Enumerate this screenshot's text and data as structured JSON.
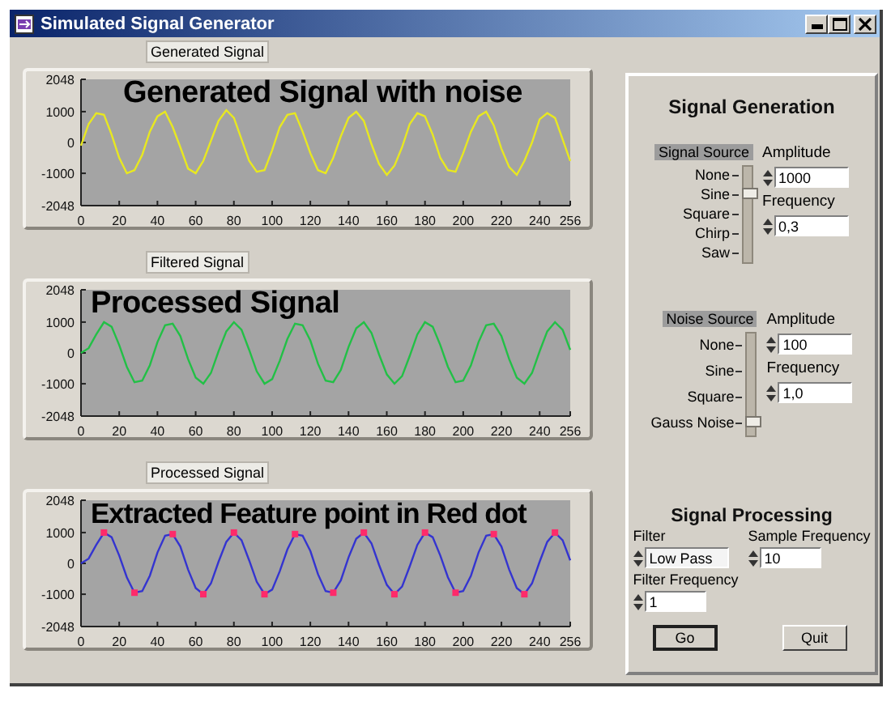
{
  "window": {
    "title": "Simulated Signal Generator"
  },
  "graphs": [
    {
      "label": "Generated Signal",
      "caption": "Generated Signal with noise",
      "chart_data": {
        "type": "line",
        "xlim": [
          0,
          256
        ],
        "ylim": [
          -2048,
          2048
        ],
        "xticks": [
          0,
          20,
          40,
          60,
          80,
          100,
          120,
          140,
          160,
          180,
          200,
          220,
          240,
          256
        ],
        "yticks": [
          -2048,
          -1000,
          0,
          1000,
          2048
        ],
        "x": [
          0,
          4,
          8,
          12,
          16,
          20,
          24,
          28,
          32,
          36,
          40,
          44,
          48,
          52,
          56,
          60,
          64,
          68,
          72,
          76,
          80,
          84,
          88,
          92,
          96,
          100,
          104,
          108,
          112,
          116,
          120,
          124,
          128,
          132,
          136,
          140,
          144,
          148,
          152,
          156,
          160,
          164,
          168,
          172,
          176,
          180,
          184,
          188,
          192,
          196,
          200,
          204,
          208,
          212,
          216,
          220,
          224,
          228,
          232,
          236,
          240,
          244,
          248,
          252,
          256
        ],
        "series": [
          {
            "color": "#e8e820",
            "values": [
              -100,
              600,
              950,
              900,
              250,
              -500,
              -1000,
              -900,
              -400,
              350,
              850,
              1000,
              500,
              -150,
              -850,
              -1000,
              -600,
              50,
              700,
              1050,
              800,
              100,
              -600,
              -950,
              -900,
              -250,
              500,
              900,
              950,
              350,
              -350,
              -900,
              -1000,
              -500,
              200,
              800,
              1000,
              700,
              -50,
              -700,
              -1050,
              -750,
              -150,
              600,
              950,
              850,
              250,
              -500,
              -900,
              -950,
              -350,
              350,
              850,
              1000,
              550,
              -200,
              -800,
              -1050,
              -600,
              0,
              750,
              950,
              800,
              100,
              -600
            ]
          }
        ]
      }
    },
    {
      "label": "Filtered Signal",
      "caption": "Processed Signal",
      "chart_data": {
        "type": "line",
        "xlim": [
          0,
          256
        ],
        "ylim": [
          -2048,
          2048
        ],
        "xticks": [
          0,
          20,
          40,
          60,
          80,
          100,
          120,
          140,
          160,
          180,
          200,
          220,
          240,
          256
        ],
        "yticks": [
          -2048,
          -1000,
          0,
          1000,
          2048
        ],
        "x": [
          0,
          4,
          8,
          12,
          16,
          20,
          24,
          28,
          32,
          36,
          40,
          44,
          48,
          52,
          56,
          60,
          64,
          68,
          72,
          76,
          80,
          84,
          88,
          92,
          96,
          100,
          104,
          108,
          112,
          116,
          120,
          124,
          128,
          132,
          136,
          140,
          144,
          148,
          152,
          156,
          160,
          164,
          168,
          172,
          176,
          180,
          184,
          188,
          192,
          196,
          200,
          204,
          208,
          212,
          216,
          220,
          224,
          228,
          232,
          236,
          240,
          244,
          248,
          252,
          256
        ],
        "series": [
          {
            "color": "#22c046",
            "values": [
              0,
              150,
              600,
              1000,
              850,
              250,
              -450,
              -950,
              -900,
              -400,
              350,
              900,
              950,
              550,
              -200,
              -800,
              -1000,
              -650,
              50,
              700,
              1000,
              750,
              100,
              -600,
              -1000,
              -850,
              -250,
              450,
              950,
              900,
              400,
              -350,
              -900,
              -950,
              -550,
              200,
              800,
              1000,
              650,
              -50,
              -700,
              -1000,
              -750,
              -100,
              600,
              1000,
              850,
              250,
              -450,
              -950,
              -900,
              -400,
              350,
              900,
              950,
              550,
              -200,
              -800,
              -1000,
              -650,
              50,
              700,
              1000,
              750,
              100
            ]
          }
        ]
      }
    },
    {
      "label": "Processed Signal",
      "caption": "Extracted Feature point in Red dot",
      "chart_data": {
        "type": "line",
        "xlim": [
          0,
          256
        ],
        "ylim": [
          -2048,
          2048
        ],
        "xticks": [
          0,
          20,
          40,
          60,
          80,
          100,
          120,
          140,
          160,
          180,
          200,
          220,
          240,
          256
        ],
        "yticks": [
          -2048,
          -1000,
          0,
          1000,
          2048
        ],
        "x": [
          0,
          4,
          8,
          12,
          16,
          20,
          24,
          28,
          32,
          36,
          40,
          44,
          48,
          52,
          56,
          60,
          64,
          68,
          72,
          76,
          80,
          84,
          88,
          92,
          96,
          100,
          104,
          108,
          112,
          116,
          120,
          124,
          128,
          132,
          136,
          140,
          144,
          148,
          152,
          156,
          160,
          164,
          168,
          172,
          176,
          180,
          184,
          188,
          192,
          196,
          200,
          204,
          208,
          212,
          216,
          220,
          224,
          228,
          232,
          236,
          240,
          244,
          248,
          252,
          256
        ],
        "series": [
          {
            "color": "#3434d0",
            "values": [
              0,
              150,
              600,
              1000,
              850,
              250,
              -450,
              -950,
              -900,
              -400,
              350,
              900,
              950,
              550,
              -200,
              -800,
              -1000,
              -650,
              50,
              700,
              1000,
              750,
              100,
              -600,
              -1000,
              -850,
              -250,
              450,
              950,
              900,
              400,
              -350,
              -900,
              -950,
              -550,
              200,
              800,
              1000,
              650,
              -50,
              -700,
              -1000,
              -750,
              -100,
              600,
              1000,
              850,
              250,
              -450,
              -950,
              -900,
              -400,
              350,
              900,
              950,
              550,
              -200,
              -800,
              -1000,
              -650,
              50,
              700,
              1000,
              750,
              100
            ]
          }
        ]
      },
      "feature_points": {
        "chart_data": {
          "type": "scatter",
          "xlim": [
            0,
            256
          ],
          "ylim": [
            -2048,
            2048
          ],
          "x": [
            12,
            28,
            48,
            64,
            80,
            96,
            112,
            132,
            148,
            164,
            180,
            196,
            216,
            232,
            248
          ],
          "series": [
            {
              "color": "#ff2a6a",
              "values": [
                1000,
                -950,
                950,
                -1000,
                1000,
                -1000,
                950,
                -950,
                1000,
                -1000,
                1000,
                -950,
                950,
                -1000,
                1000
              ]
            }
          ]
        }
      }
    }
  ],
  "signal_generation": {
    "title": "Signal Generation",
    "signal_source": {
      "label": "Signal Source",
      "options": [
        {
          "label": "None",
          "selected": false
        },
        {
          "label": "Sine",
          "selected": true
        },
        {
          "label": "Square",
          "selected": false
        },
        {
          "label": "Chirp",
          "selected": false
        },
        {
          "label": "Saw",
          "selected": false
        }
      ]
    },
    "signal_amplitude": {
      "label": "Amplitude",
      "value": "1000"
    },
    "signal_frequency": {
      "label": "Frequency",
      "value": "0,3"
    },
    "noise_source": {
      "label": "Noise Source",
      "options": [
        {
          "label": "None",
          "selected": false
        },
        {
          "label": "Sine",
          "selected": false
        },
        {
          "label": "Square",
          "selected": false
        },
        {
          "label": "Gauss Noise",
          "selected": true
        }
      ]
    },
    "noise_amplitude": {
      "label": "Amplitude",
      "value": "100"
    },
    "noise_frequency": {
      "label": "Frequency",
      "value": "1,0"
    }
  },
  "signal_processing": {
    "title": "Signal Processing",
    "filter": {
      "label": "Filter",
      "value": "Low Pass"
    },
    "sample_frequency": {
      "label": "Sample Frequency",
      "value": "10"
    },
    "filter_frequency": {
      "label": "Filter Frequency",
      "value": "1"
    },
    "buttons": [
      {
        "label": "Go",
        "default": true
      },
      {
        "label": "Quit",
        "default": false
      }
    ]
  }
}
